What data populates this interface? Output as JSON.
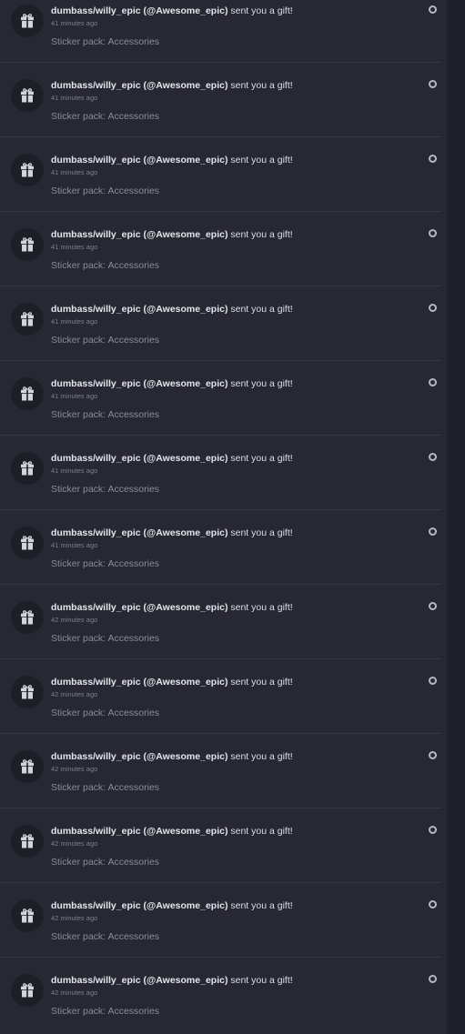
{
  "notifications": [
    {
      "sender": "dumbass/willy_epic (@Awesome_epic)",
      "message": "sent you a gift!",
      "time": "41 minutes ago",
      "detail": "Sticker pack: Accessories",
      "icon": "gift-icon"
    },
    {
      "sender": "dumbass/willy_epic (@Awesome_epic)",
      "message": "sent you a gift!",
      "time": "41 minutes ago",
      "detail": "Sticker pack: Accessories",
      "icon": "gift-icon"
    },
    {
      "sender": "dumbass/willy_epic (@Awesome_epic)",
      "message": "sent you a gift!",
      "time": "41 minutes ago",
      "detail": "Sticker pack: Accessories",
      "icon": "gift-icon"
    },
    {
      "sender": "dumbass/willy_epic (@Awesome_epic)",
      "message": "sent you a gift!",
      "time": "41 minutes ago",
      "detail": "Sticker pack: Accessories",
      "icon": "gift-icon"
    },
    {
      "sender": "dumbass/willy_epic (@Awesome_epic)",
      "message": "sent you a gift!",
      "time": "41 minutes ago",
      "detail": "Sticker pack: Accessories",
      "icon": "gift-icon"
    },
    {
      "sender": "dumbass/willy_epic (@Awesome_epic)",
      "message": "sent you a gift!",
      "time": "41 minutes ago",
      "detail": "Sticker pack: Accessories",
      "icon": "gift-icon"
    },
    {
      "sender": "dumbass/willy_epic (@Awesome_epic)",
      "message": "sent you a gift!",
      "time": "41 minutes ago",
      "detail": "Sticker pack: Accessories",
      "icon": "gift-icon"
    },
    {
      "sender": "dumbass/willy_epic (@Awesome_epic)",
      "message": "sent you a gift!",
      "time": "41 minutes ago",
      "detail": "Sticker pack: Accessories",
      "icon": "gift-icon"
    },
    {
      "sender": "dumbass/willy_epic (@Awesome_epic)",
      "message": "sent you a gift!",
      "time": "42 minutes ago",
      "detail": "Sticker pack: Accessories",
      "icon": "gift-icon"
    },
    {
      "sender": "dumbass/willy_epic (@Awesome_epic)",
      "message": "sent you a gift!",
      "time": "42 minutes ago",
      "detail": "Sticker pack: Accessories",
      "icon": "gift-icon"
    },
    {
      "sender": "dumbass/willy_epic (@Awesome_epic)",
      "message": "sent you a gift!",
      "time": "42 minutes ago",
      "detail": "Sticker pack: Accessories",
      "icon": "gift-icon"
    },
    {
      "sender": "dumbass/willy_epic (@Awesome_epic)",
      "message": "sent you a gift!",
      "time": "42 minutes ago",
      "detail": "Sticker pack: Accessories",
      "icon": "gift-icon"
    },
    {
      "sender": "dumbass/willy_epic (@Awesome_epic)",
      "message": "sent you a gift!",
      "time": "42 minutes ago",
      "detail": "Sticker pack: Accessories",
      "icon": "gift-icon"
    },
    {
      "sender": "dumbass/willy_epic (@Awesome_epic)",
      "message": "sent you a gift!",
      "time": "42 minutes ago",
      "detail": "Sticker pack: Accessories",
      "icon": "gift-icon"
    }
  ],
  "colors": {
    "panel_background": "#272833",
    "page_background": "#1f2029",
    "divider": "#353642",
    "primary_text": "#dcdde3",
    "secondary_text": "#8b8c96",
    "unread_indicator": "#b7b8c0"
  }
}
